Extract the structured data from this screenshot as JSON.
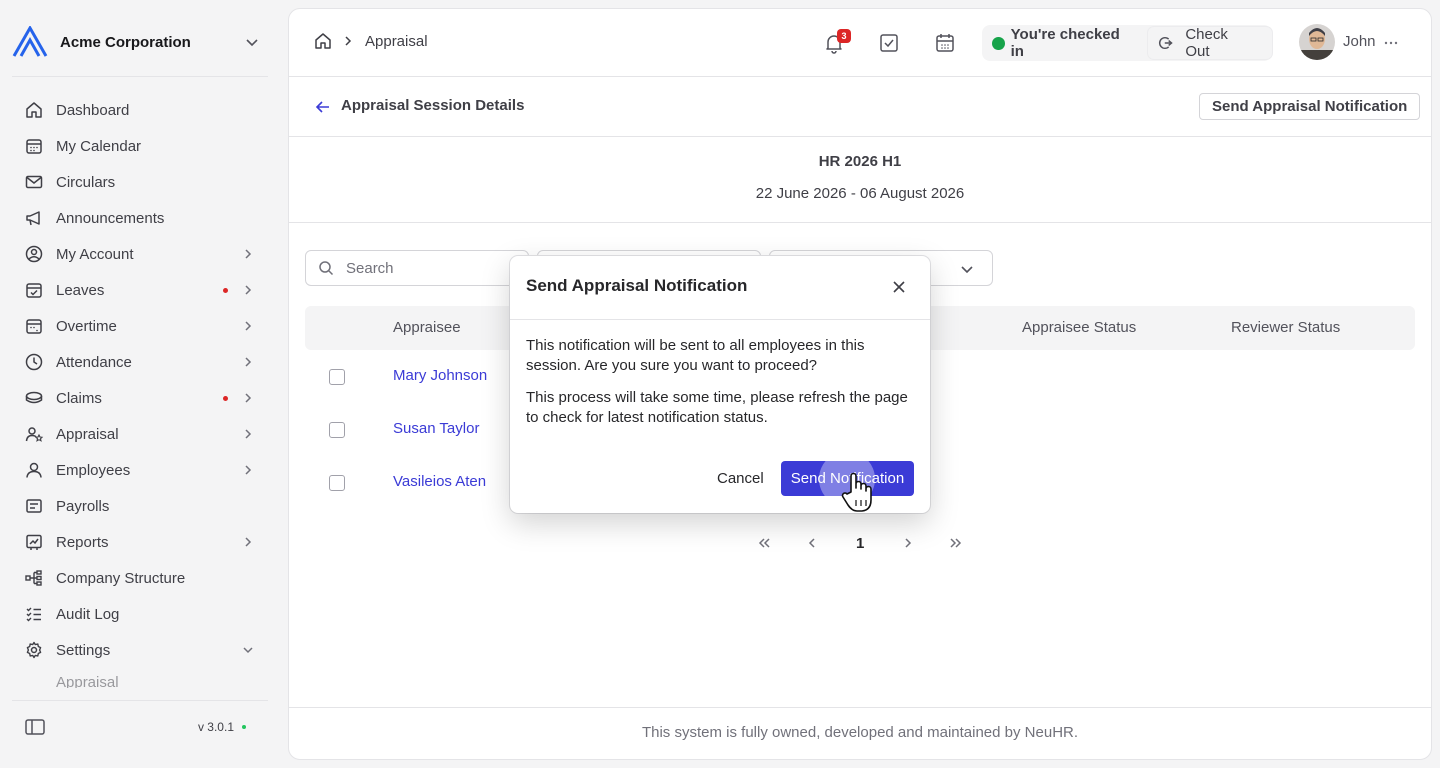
{
  "org": {
    "name": "Acme Corporation"
  },
  "sidebar": {
    "items": [
      {
        "label": "Dashboard",
        "icon": "home-icon",
        "arrow": false,
        "dot": false
      },
      {
        "label": "My Calendar",
        "icon": "calendar-icon",
        "arrow": false,
        "dot": false
      },
      {
        "label": "Circulars",
        "icon": "mail-icon",
        "arrow": false,
        "dot": false
      },
      {
        "label": "Announcements",
        "icon": "megaphone-icon",
        "arrow": false,
        "dot": false
      },
      {
        "label": "My Account",
        "icon": "user-circle-icon",
        "arrow": true,
        "dot": false
      },
      {
        "label": "Leaves",
        "icon": "calendar-check-icon",
        "arrow": true,
        "dot": true
      },
      {
        "label": "Overtime",
        "icon": "calendar-clock-icon",
        "arrow": true,
        "dot": false
      },
      {
        "label": "Attendance",
        "icon": "clock-icon",
        "arrow": true,
        "dot": false
      },
      {
        "label": "Claims",
        "icon": "coins-icon",
        "arrow": true,
        "dot": true
      },
      {
        "label": "Appraisal",
        "icon": "user-star-icon",
        "arrow": true,
        "dot": false
      },
      {
        "label": "Employees",
        "icon": "user-icon",
        "arrow": true,
        "dot": false
      },
      {
        "label": "Payrolls",
        "icon": "receipt-icon",
        "arrow": false,
        "dot": false
      },
      {
        "label": "Reports",
        "icon": "chart-icon",
        "arrow": true,
        "dot": false
      },
      {
        "label": "Company Structure",
        "icon": "hierarchy-icon",
        "arrow": false,
        "dot": false
      },
      {
        "label": "Audit Log",
        "icon": "checklist-icon",
        "arrow": false,
        "dot": false
      },
      {
        "label": "Settings",
        "icon": "gear-icon",
        "arrow": "down",
        "dot": false
      }
    ],
    "partial_item": "Appraisal",
    "version": "v 3.0.1"
  },
  "topbar": {
    "breadcrumb": "Appraisal",
    "notification_count": "3",
    "checkin_status": "You're checked in",
    "checkout_label": "Check Out",
    "user_name": "John"
  },
  "page": {
    "title": "Appraisal Session Details",
    "send_button": "Send Appraisal Notification",
    "session_name": "HR 2026 H1",
    "session_dates": "22 June 2026 - 06 August 2026"
  },
  "filters": {
    "search_placeholder": "Search"
  },
  "table": {
    "columns": [
      "Appraisee",
      "Appraisee Status",
      "Reviewer Status"
    ],
    "rows": [
      "Mary Johnson",
      "Susan Taylor",
      "Vasileios Aten"
    ]
  },
  "pager": {
    "current": "1"
  },
  "footer": "This system is fully owned, developed and maintained by NeuHR.",
  "dialog": {
    "title": "Send Appraisal Notification",
    "paragraph1": "This notification will be sent to all employees in this session. Are you sure you want to proceed?",
    "paragraph2": "This process will take some time, please refresh the page to check for latest notification status.",
    "cancel": "Cancel",
    "confirm": "Send Notification"
  },
  "colors": {
    "accent": "#3b3bd6",
    "danger": "#dc2626",
    "success": "#16a34a",
    "logo": "#2563eb"
  }
}
